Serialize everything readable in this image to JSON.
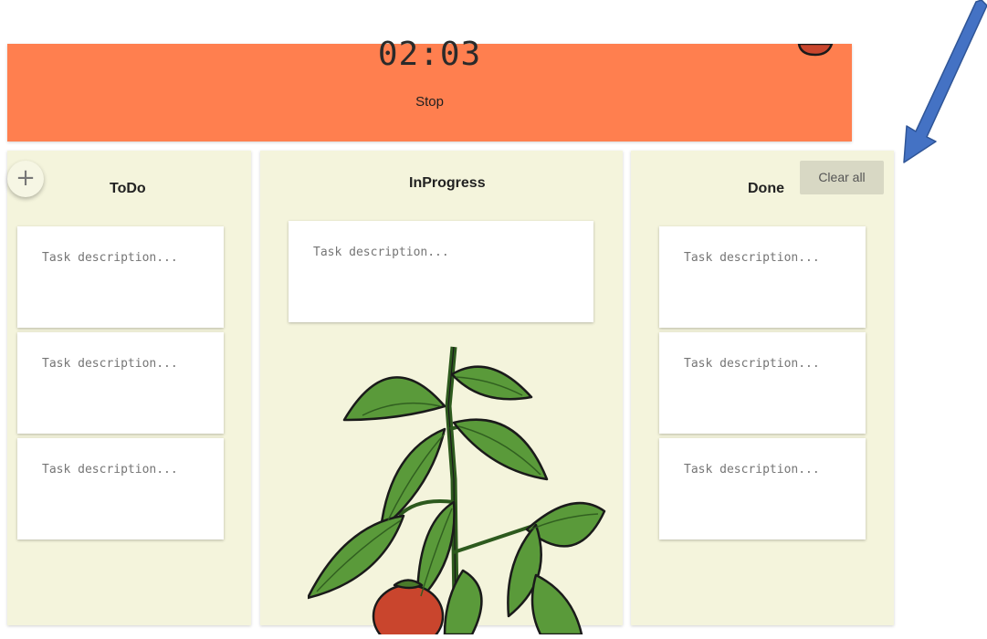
{
  "timer": {
    "time": "02:03",
    "stop_label": "Stop"
  },
  "columns": {
    "todo": {
      "title": "ToDo",
      "add_symbol": "+",
      "cards": [
        "Task description...",
        "Task description...",
        "Task description..."
      ]
    },
    "inprogress": {
      "title": "InProgress",
      "cards": [
        "Task description..."
      ]
    },
    "done": {
      "title": "Done",
      "clear_label": "Clear all",
      "cards": [
        "Task description...",
        "Task description...",
        "Task description..."
      ]
    }
  },
  "colors": {
    "timer_bar": "#ff7f4f",
    "column_bg": "#f4f4dc",
    "clear_button": "#d8d8c4",
    "arrow": "#4472c4"
  },
  "icons": [
    "tomato-plant-illustration",
    "tomato-icon",
    "annotation-arrow",
    "add-icon"
  ]
}
